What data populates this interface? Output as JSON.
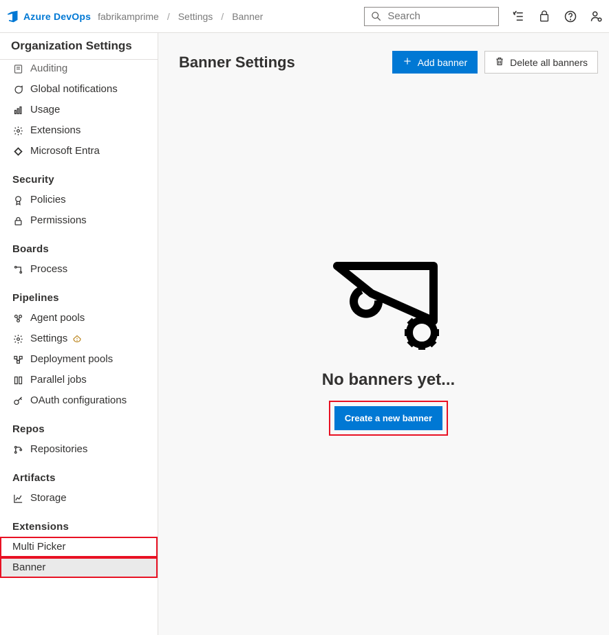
{
  "brand": "Azure DevOps",
  "breadcrumbs": {
    "org": "fabrikamprime",
    "section": "Settings",
    "page": "Banner"
  },
  "search": {
    "placeholder": "Search"
  },
  "sidebar": {
    "header": "Organization Settings",
    "items": {
      "auditing": "Auditing",
      "global_notifications": "Global notifications",
      "usage": "Usage",
      "extensions": "Extensions",
      "ms_entra": "Microsoft Entra"
    },
    "groups": {
      "security": {
        "title": "Security",
        "policies": "Policies",
        "permissions": "Permissions"
      },
      "boards": {
        "title": "Boards",
        "process": "Process"
      },
      "pipelines": {
        "title": "Pipelines",
        "agent_pools": "Agent pools",
        "settings": "Settings",
        "deployment_pools": "Deployment pools",
        "parallel_jobs": "Parallel jobs",
        "oauth": "OAuth configurations"
      },
      "repos": {
        "title": "Repos",
        "repositories": "Repositories"
      },
      "artifacts": {
        "title": "Artifacts",
        "storage": "Storage"
      },
      "ext": {
        "title": "Extensions",
        "multi_picker": "Multi Picker",
        "banner": "Banner"
      }
    }
  },
  "main": {
    "title": "Banner Settings",
    "add_banner": "Add banner",
    "delete_all": "Delete all banners",
    "empty_title": "No banners yet...",
    "create_button": "Create a new banner"
  }
}
